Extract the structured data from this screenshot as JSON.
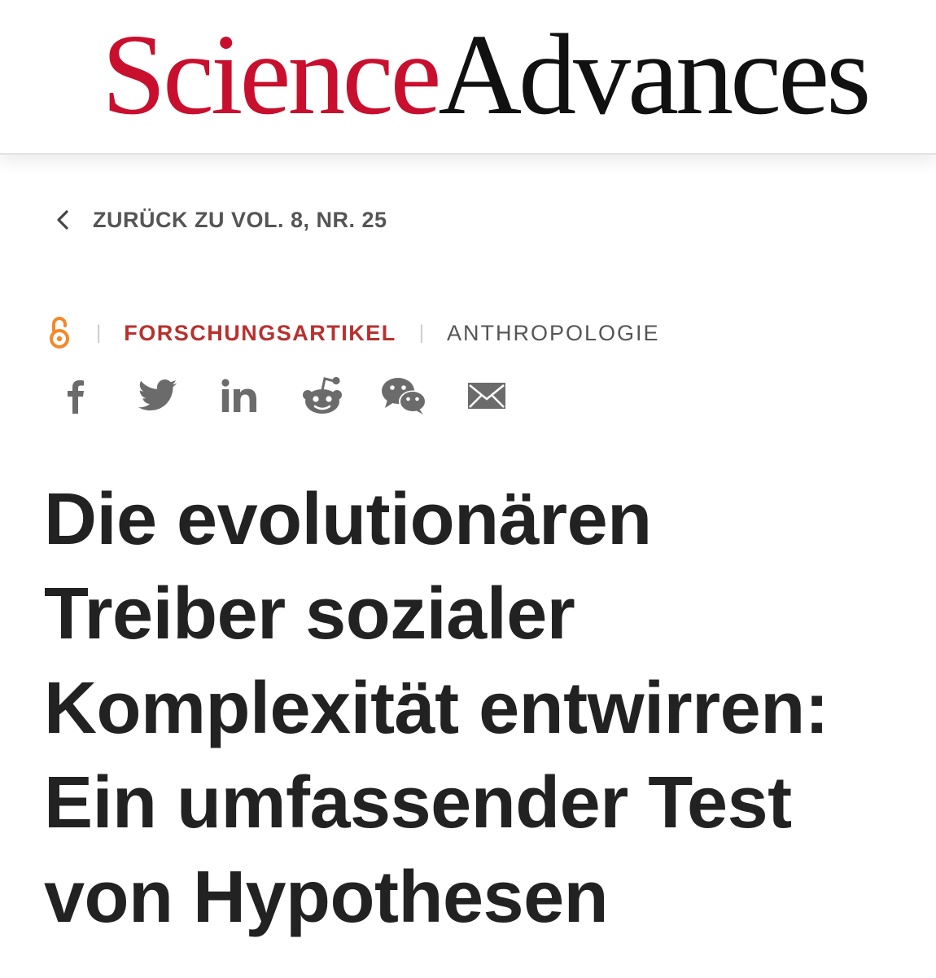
{
  "header": {
    "logo_part1": "Science",
    "logo_part2": "Advances"
  },
  "breadcrumb": {
    "back_label": "ZURÜCK ZU VOL. 8, NR. 25",
    "icon": "chevron-left-icon"
  },
  "article_meta": {
    "access_icon": "open-access-icon",
    "article_type": "FORSCHUNGSARTIKEL",
    "subject": "ANTHROPOLOGIE"
  },
  "share": {
    "icons": [
      "facebook-icon",
      "twitter-icon",
      "linkedin-icon",
      "reddit-icon",
      "wechat-icon",
      "email-icon"
    ]
  },
  "article": {
    "title": "Die evolutionären Treiber sozialer Komplexität entwirren: Ein umfassender Test von Hypothesen"
  },
  "colors": {
    "brand_red": "#c8102e",
    "article_type_red": "#b8312f",
    "open_access_orange": "#f4882a",
    "icon_gray": "#6b6b6b",
    "title_text": "#222222"
  }
}
